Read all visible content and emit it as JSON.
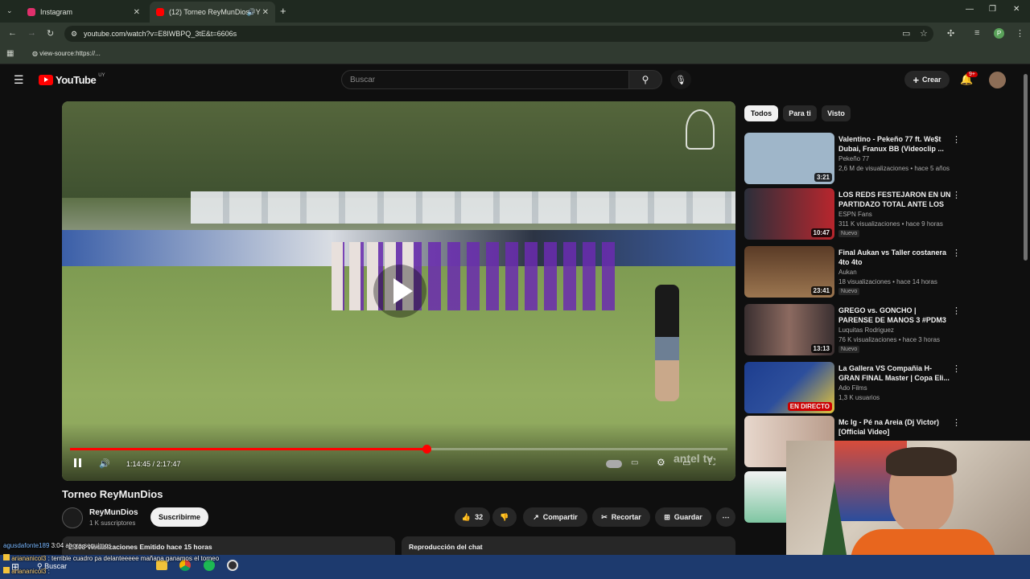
{
  "browser": {
    "tabs": [
      {
        "title": "Instagram",
        "favicon_color": "#e1306c"
      },
      {
        "title": "(12) Torneo ReyMunDios - Y",
        "favicon_color": "#ff0000"
      }
    ],
    "url": "youtube.com/watch?v=E8IWBPQ_3tE&t=6606s",
    "bookmark": "view-source:https://..."
  },
  "youtube": {
    "logo_text": "YouTube",
    "logo_region": "UY",
    "search_placeholder": "Buscar",
    "create_label": "Crear",
    "notifications": "9+",
    "video": {
      "time": "1:14:45 / 2:17:47",
      "progress": 0.542,
      "watermark": "antel tv"
    },
    "title": "Torneo ReyMunDios",
    "channel": {
      "name": "ReyMunDios",
      "subs": "1 K suscriptores",
      "subscribe_label": "Suscribirme"
    },
    "actions": {
      "likes": "32",
      "share": "Compartir",
      "clip": "Recortar",
      "save": "Guardar"
    },
    "description_header": "2.308 visualizaciones  Emitido hace 15 horas",
    "chat_header": "Reproducción del chat",
    "chips": [
      "Todos",
      "Para ti",
      "Visto"
    ],
    "recommendations": [
      {
        "title": "Valentino - Pekeño 77 ft. We$t Dubai, Franux BB (Videoclip ...",
        "channel": "Pekeño 77",
        "views": "2,6 M de visualizaciones • hace 5 años",
        "duration": "3:21",
        "badge": "",
        "thumb": "#9fb6c9"
      },
      {
        "title": "LOS REDS FESTEJARON EN UN PARTIDAZO TOTAL ANTE LOS ...",
        "channel": "ESPN Fans",
        "views": "311 K visualizaciones • hace 9 horas",
        "duration": "10:47",
        "badge": "Nuevo",
        "thumb": "#b8262d"
      },
      {
        "title": "Final Aukan vs Taller costanera 4to 4to",
        "channel": "Aukan",
        "views": "18 visualizaciones • hace 14 horas",
        "duration": "23:41",
        "badge": "Nuevo",
        "thumb": "#7a5a3c"
      },
      {
        "title": "GREGO vs. GONCHO | PARENSE DE MANOS 3 #PDM3",
        "channel": "Luquitas Rodriguez",
        "views": "76 K visualizaciones • hace 3 horas",
        "duration": "13:13",
        "badge": "Nuevo",
        "thumb": "#5b4a48"
      },
      {
        "title": "La Gallera VS Compañia H- GRAN FINAL Master | Copa Eli...",
        "channel": "Ado Films",
        "views": "1,3 K usuarios",
        "duration": "EN DIRECTO",
        "badge": "",
        "thumb": "#2d4f9c"
      },
      {
        "title": "Mc Ig - Pé na Areia (Dj Victor) [Official Video]",
        "channel": "",
        "views": "",
        "duration": "",
        "badge": "",
        "thumb": "#d9c2b5"
      }
    ]
  },
  "overlay_chat": [
    {
      "user": "agusdafonte189",
      "text": "3:04 ahora seguimos"
    },
    {
      "user": "ariananicol3",
      "text": ": terrible cuadro pa delanteeeee mañana ganamos el torneo"
    },
    {
      "user": "ariananicol3",
      "text": ":"
    }
  ],
  "taskbar": {
    "search_label": "Buscar"
  }
}
